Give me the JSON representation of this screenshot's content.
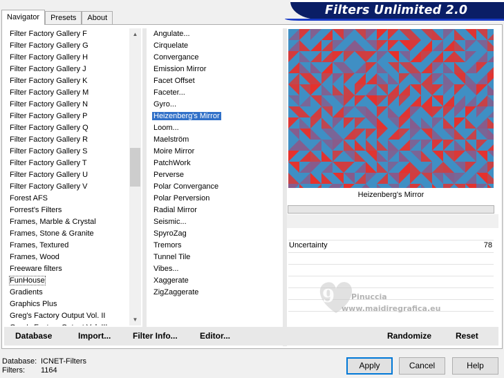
{
  "tabs": [
    {
      "label": "Navigator",
      "active": true
    },
    {
      "label": "Presets",
      "active": false
    },
    {
      "label": "About",
      "active": false
    }
  ],
  "banner_title": "Filters Unlimited 2.0",
  "categories": [
    "Filter Factory Gallery F",
    "Filter Factory Gallery G",
    "Filter Factory Gallery H",
    "Filter Factory Gallery J",
    "Filter Factory Gallery K",
    "Filter Factory Gallery M",
    "Filter Factory Gallery N",
    "Filter Factory Gallery P",
    "Filter Factory Gallery Q",
    "Filter Factory Gallery R",
    "Filter Factory Gallery S",
    "Filter Factory Gallery T",
    "Filter Factory Gallery U",
    "Filter Factory Gallery V",
    "Forest AFS",
    "Forrest's Filters",
    "Frames, Marble & Crystal",
    "Frames, Stone & Granite",
    "Frames, Textured",
    "Frames, Wood",
    "Freeware filters",
    "FunHouse",
    "Gradients",
    "Graphics Plus",
    "Greg's Factory Output Vol. II",
    "Greg's Factory Output Vol. III"
  ],
  "focused_category": "FunHouse",
  "filters": [
    "Angulate...",
    "Cirquelate",
    "Convergance",
    "Emission Mirror",
    "Facet Offset",
    "Faceter...",
    "Gyro...",
    "Heizenberg's Mirror",
    "Loom...",
    "Maelström",
    "Moire Mirror",
    "PatchWork",
    "Perverse",
    "Polar Convergance",
    "Polar Perversion",
    "Radial Mirror",
    "Seismic...",
    "SpyroZag",
    "Tremors",
    "Tunnel Tile",
    "Vibes...",
    "Xaggerate",
    "ZigZaggerate"
  ],
  "selected_filter": "Heizenberg's Mirror",
  "left_buttons": {
    "database": "Database",
    "import": "Import...",
    "filter_info": "Filter Info...",
    "editor": "Editor..."
  },
  "preview_label": "Heizenberg's Mirror",
  "parameters": [
    {
      "name": "Uncertainty",
      "value": "78"
    }
  ],
  "right_buttons": {
    "randomize": "Randomize",
    "reset": "Reset"
  },
  "watermark": {
    "name": "Pinuccia",
    "site": "www.maidiregrafica.eu"
  },
  "status": {
    "database_label": "Database:",
    "database_value": "ICNET-Filters",
    "filters_label": "Filters:",
    "filters_value": "1164"
  },
  "dialog_buttons": {
    "apply": "Apply",
    "cancel": "Cancel",
    "help": "Help"
  },
  "colors": {
    "banner": "#0a1e66",
    "selection": "#3070c8",
    "preview_blue": "#3f8fc4",
    "preview_red": "#e8302a"
  }
}
